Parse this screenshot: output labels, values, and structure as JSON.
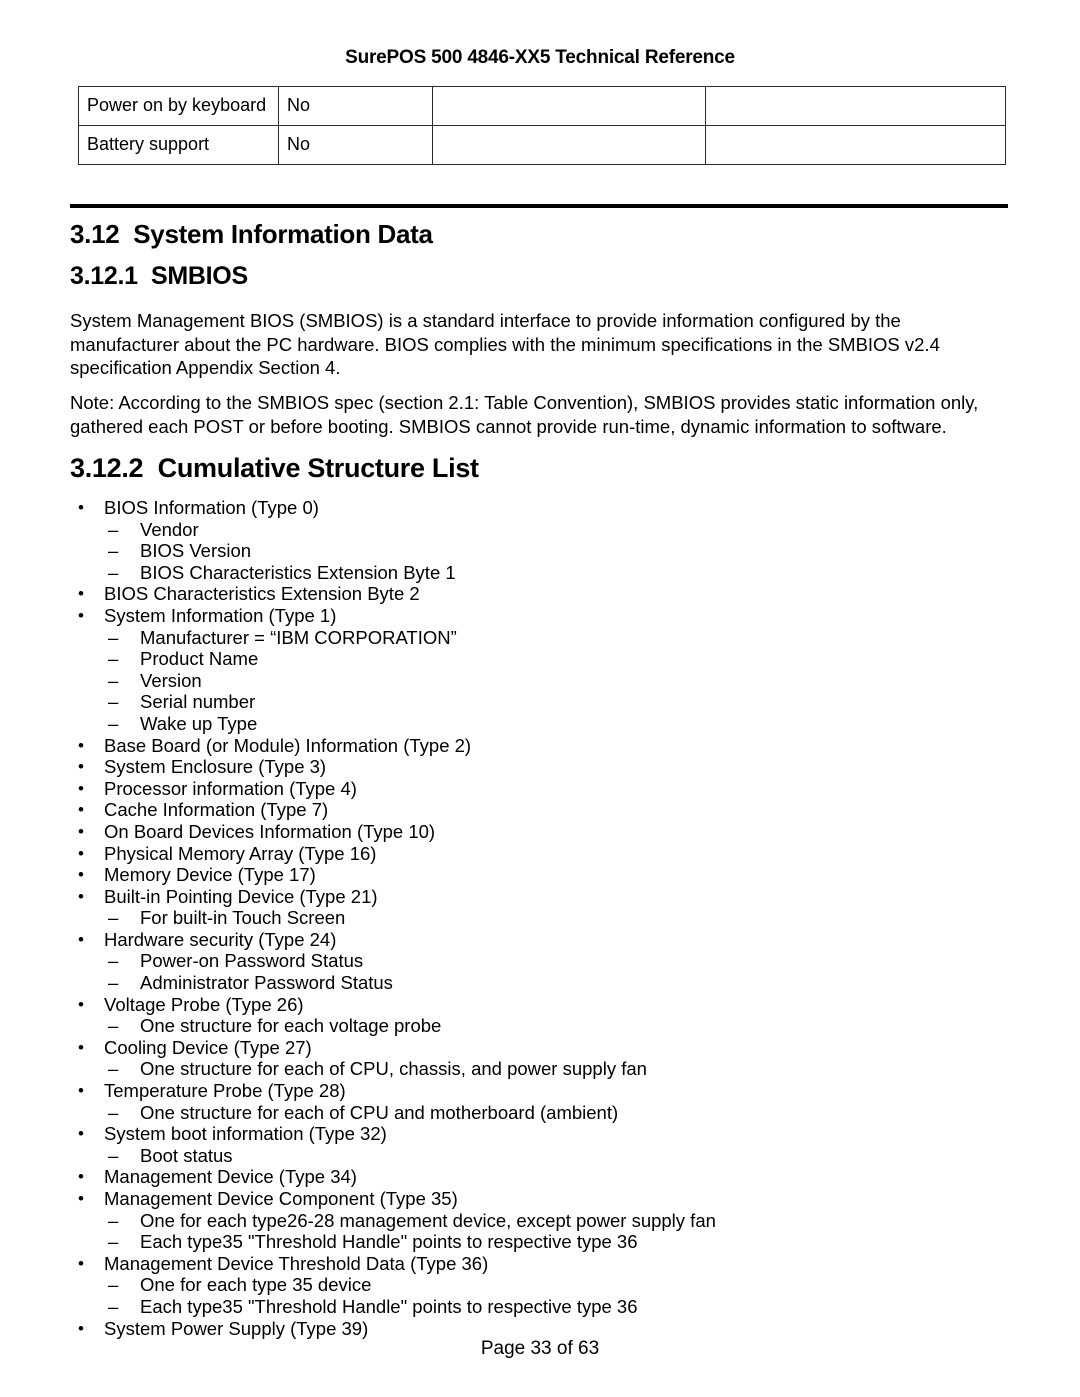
{
  "header": {
    "title": "SurePOS 500 4846-XX5 Technical Reference"
  },
  "spec_table": {
    "rows": [
      {
        "label": "Power on by keyboard",
        "value": "No",
        "blank1": "",
        "blank2": ""
      },
      {
        "label": "Battery support",
        "value": "No",
        "blank1": "",
        "blank2": ""
      }
    ]
  },
  "headings": {
    "section_312": "3.12  System Information Data",
    "section_3121": "3.12.1  SMBIOS",
    "section_3122": "3.12.2  Cumulative Structure List"
  },
  "paragraphs": {
    "smbios": "System Management BIOS (SMBIOS) is a standard interface to provide information configured by the manufacturer about the PC hardware.  BIOS complies with the minimum specifications in the SMBIOS v2.4 specification Appendix Section 4.",
    "note": "Note: According to the SMBIOS spec (section 2.1: Table Convention), SMBIOS provides static information only, gathered each POST or before booting.  SMBIOS cannot provide run-time, dynamic information to software."
  },
  "markers": {
    "bullet": "•",
    "dash": "–"
  },
  "structure_list": [
    {
      "level": 1,
      "text": "BIOS Information (Type 0)"
    },
    {
      "level": 2,
      "text": "Vendor"
    },
    {
      "level": 2,
      "text": "BIOS Version"
    },
    {
      "level": 2,
      "text": "BIOS Characteristics Extension Byte 1"
    },
    {
      "level": 1,
      "text": "BIOS Characteristics Extension Byte 2"
    },
    {
      "level": 1,
      "text": "System Information (Type 1)"
    },
    {
      "level": 2,
      "text": "Manufacturer = “IBM CORPORATION”"
    },
    {
      "level": 2,
      "text": "Product Name"
    },
    {
      "level": 2,
      "text": "Version"
    },
    {
      "level": 2,
      "text": "Serial number"
    },
    {
      "level": 2,
      "text": "Wake up Type"
    },
    {
      "level": 1,
      "text": "Base Board (or Module) Information (Type 2)"
    },
    {
      "level": 1,
      "text": "System Enclosure (Type 3)"
    },
    {
      "level": 1,
      "text": "Processor information (Type 4)"
    },
    {
      "level": 1,
      "text": "Cache Information (Type 7)"
    },
    {
      "level": 1,
      "text": "On Board Devices Information (Type 10)"
    },
    {
      "level": 1,
      "text": "Physical Memory Array (Type 16)"
    },
    {
      "level": 1,
      "text": "Memory Device (Type 17)"
    },
    {
      "level": 1,
      "text": "Built-in Pointing Device (Type 21)"
    },
    {
      "level": 2,
      "text": "For built-in Touch Screen"
    },
    {
      "level": 1,
      "text": "Hardware security (Type 24)"
    },
    {
      "level": 2,
      "text": "Power-on Password Status"
    },
    {
      "level": 2,
      "text": "Administrator Password Status"
    },
    {
      "level": 1,
      "text": "Voltage Probe (Type 26)"
    },
    {
      "level": 2,
      "text": "One structure for each voltage probe"
    },
    {
      "level": 1,
      "text": "Cooling Device (Type 27)"
    },
    {
      "level": 2,
      "text": "One structure for each of CPU, chassis, and power supply fan"
    },
    {
      "level": 1,
      "text": "Temperature Probe (Type 28)"
    },
    {
      "level": 2,
      "text": "One structure for each of CPU and motherboard (ambient)"
    },
    {
      "level": 1,
      "text": "System boot information (Type 32)"
    },
    {
      "level": 2,
      "text": "Boot status"
    },
    {
      "level": 1,
      "text": "Management Device (Type 34)"
    },
    {
      "level": 1,
      "text": "Management Device Component (Type 35)"
    },
    {
      "level": 2,
      "text": "One for each type26-28 management device, except power supply fan"
    },
    {
      "level": 2,
      "text": "Each type35 \"Threshold Handle\" points to respective type 36"
    },
    {
      "level": 1,
      "text": "Management Device Threshold Data (Type 36)"
    },
    {
      "level": 2,
      "text": "One for each type 35 device"
    },
    {
      "level": 2,
      "text": "Each type35 \"Threshold Handle\" points to respective type 36"
    },
    {
      "level": 1,
      "text": "System Power Supply (Type 39)"
    }
  ],
  "footer": {
    "page_label": "Page 33 of 63"
  }
}
